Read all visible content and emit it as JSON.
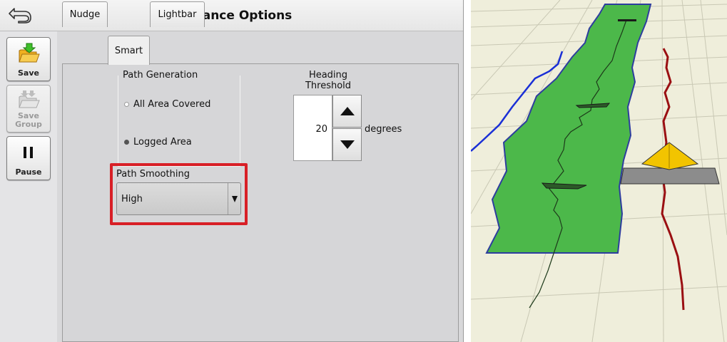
{
  "header": {
    "title": "Guidance Options",
    "back_icon": "back-arrow-icon"
  },
  "sidebar": {
    "buttons": [
      {
        "label": "Save",
        "icon": "save-folder-icon",
        "enabled": true
      },
      {
        "label": "Save\nGroup",
        "icon": "save-group-folder-icon",
        "enabled": false
      },
      {
        "label": "Pause",
        "icon": "pause-icon",
        "enabled": true
      }
    ]
  },
  "tabs": [
    {
      "label": "Nudge",
      "active": false
    },
    {
      "label": "Smart",
      "active": true
    },
    {
      "label": "Lightbar",
      "active": false
    }
  ],
  "path_generation": {
    "legend": "Path Generation",
    "options": [
      {
        "label": "All Area Covered",
        "selected": false
      },
      {
        "label": "Logged Area",
        "selected": true
      }
    ]
  },
  "path_smoothing": {
    "label": "Path Smoothing",
    "value": "High",
    "highlight_color": "#d81f26"
  },
  "heading_threshold": {
    "label_line1": "Heading",
    "label_line2": "Threshold",
    "value": "20",
    "units": "degrees"
  },
  "map_view": {
    "coverage_color": "#4cb84a",
    "path_color_left": "#1a2fd6",
    "path_color_right": "#9a0f12",
    "vehicle_color": "#f2c400",
    "implement_color": "#8c8c8c",
    "ground_color": "#efeedb"
  }
}
